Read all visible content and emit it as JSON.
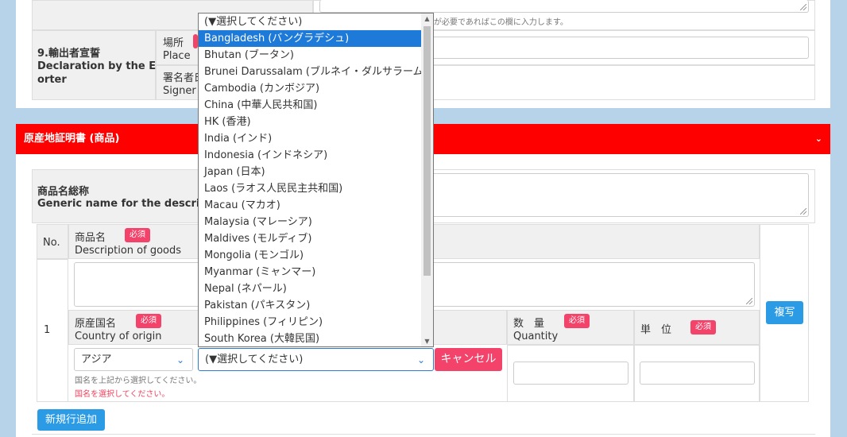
{
  "top_section": {
    "hint": "が必要であればこの欄に入力します。",
    "declaration_label_jp": "9.輸出者宣誓",
    "declaration_label_en_1": "Declaration by the Exp",
    "declaration_label_en_2": "orter",
    "place_jp": "場所",
    "place_en": "Place",
    "signer_jp": "署名者氏",
    "signer_en": "Signer N"
  },
  "section_header": {
    "title": "原産地証明書 (商品)",
    "toggle_icon": "chevron-down-icon"
  },
  "generic_name": {
    "label_jp": "商品名総称",
    "label_en": "Generic name for the description"
  },
  "goods_table": {
    "no_header": "No.",
    "desc_jp": "商品名",
    "desc_en": "Description of goods",
    "required": "必須",
    "row_no": "1",
    "origin_jp": "原産国名",
    "origin_en": "Country of origin",
    "quantity_jp": "数　量",
    "quantity_en": "Quantity",
    "unit_jp": "単　位",
    "copy_button": "複写",
    "region_select": "アジア",
    "country_select": "(▼選択してください)",
    "cancel_button": "キャンセル",
    "hint_select": "国名を上記から選択してください。",
    "error_select": "国名を選択してください。"
  },
  "add_row_button": "新規行追加",
  "dropdown": {
    "options": [
      "(▼選択してください)",
      "Bangladesh (バングラデシュ)",
      "Bhutan (ブータン)",
      "Brunei Darussalam (ブルネイ・ダルサラーム)",
      "Cambodia (カンボジア)",
      "China (中華人民共和国)",
      "HK (香港)",
      "India (インド)",
      "Indonesia (インドネシア)",
      "Japan (日本)",
      "Laos (ラオス人民民主共和国)",
      "Macau (マカオ)",
      "Malaysia (マレーシア)",
      "Maldives (モルディブ)",
      "Mongolia (モンゴル)",
      "Myanmar (ミャンマー)",
      "Nepal (ネパール)",
      "Pakistan (パキスタン)",
      "Philippines (フィリピン)",
      "South Korea (大韓民国)"
    ],
    "selected_index": 1
  },
  "colors": {
    "background": "#b7d3ea",
    "section_header": "#ff0000",
    "badge": "#f4436b",
    "primary_button": "#2c9be6",
    "highlight": "#1e7ad9"
  }
}
